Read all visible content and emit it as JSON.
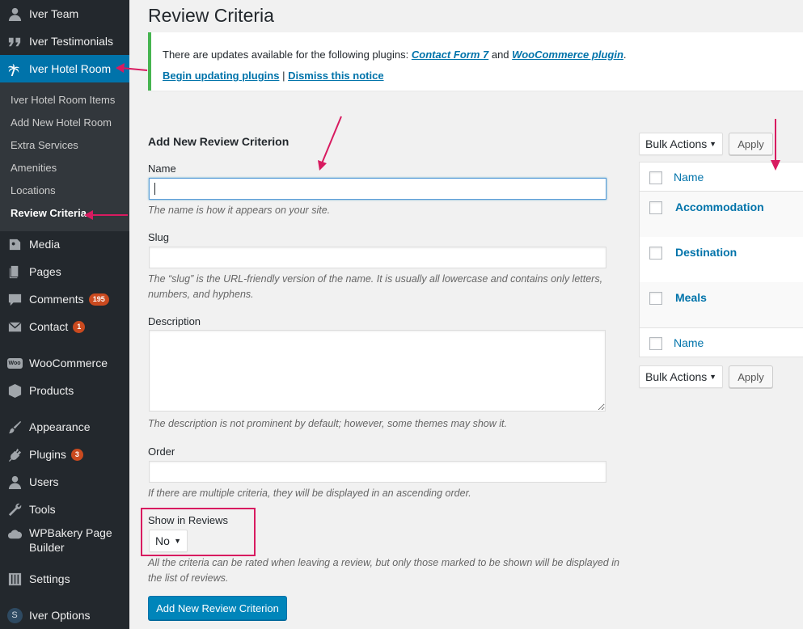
{
  "sidebar": {
    "items": [
      {
        "label": "Iver Team",
        "icon": "user-icon"
      },
      {
        "label": "Iver Testimonials",
        "icon": "quote-icon"
      },
      {
        "label": "Iver Hotel Room",
        "icon": "palm-tree-icon"
      },
      {
        "label": "Media",
        "icon": "media-icon"
      },
      {
        "label": "Pages",
        "icon": "pages-icon"
      },
      {
        "label": "Comments",
        "icon": "comment-icon",
        "badge": "195"
      },
      {
        "label": "Contact",
        "icon": "mail-icon",
        "badge": "1"
      },
      {
        "label": "WooCommerce",
        "icon": "woocommerce-icon"
      },
      {
        "label": "Products",
        "icon": "cube-icon"
      },
      {
        "label": "Appearance",
        "icon": "brush-icon"
      },
      {
        "label": "Plugins",
        "icon": "plug-icon",
        "badge": "3"
      },
      {
        "label": "Users",
        "icon": "users-icon"
      },
      {
        "label": "Tools",
        "icon": "wrench-icon"
      },
      {
        "label": "WPBakery Page Builder",
        "line1": "WPBakery Page",
        "line2": "Builder",
        "icon": "cloud-icon"
      },
      {
        "label": "Settings",
        "icon": "sliders-icon"
      },
      {
        "label": "Iver Options",
        "icon": "s-logo-icon"
      }
    ],
    "submenu": [
      "Iver Hotel Room Items",
      "Add New Hotel Room",
      "Extra Services",
      "Amenities",
      "Locations",
      "Review Criteria"
    ]
  },
  "page": {
    "title": "Review Criteria"
  },
  "notice": {
    "text_prefix": "There are updates available for the following plugins:",
    "plugin1": "Contact Form 7",
    "and": "and",
    "plugin2": "WooCommerce plugin",
    "period": ".",
    "begin_link": "Begin updating plugins",
    "separator": "|",
    "dismiss_link": "Dismiss this notice"
  },
  "form": {
    "heading": "Add New Review Criterion",
    "name_label": "Name",
    "name_value": "",
    "name_hint": "The name is how it appears on your site.",
    "slug_label": "Slug",
    "slug_value": "",
    "slug_hint_1": "The “slug” is the URL-friendly version of the name. It is usually all lowercase and contains only letters,",
    "slug_hint_2": "numbers, and hyphens.",
    "description_label": "Description",
    "description_value": "",
    "description_hint": "The description is not prominent by default; however, some themes may show it.",
    "order_label": "Order",
    "order_value": "",
    "order_hint": "If there are multiple criteria, they will be displayed in an ascending order.",
    "show_label": "Show in Reviews",
    "show_value": "No",
    "show_hint_1": "All the criteria can be rated when leaving a review, but only those marked to be shown will be displayed in",
    "show_hint_2": "the list of reviews.",
    "submit_label": "Add New Review Criterion"
  },
  "list": {
    "bulk_actions": "Bulk Actions",
    "apply": "Apply",
    "column_name": "Name",
    "rows": [
      "Accommodation",
      "Destination",
      "Meals"
    ]
  },
  "colors": {
    "sidebar_bg": "#23282d",
    "active_bg": "#0073aa",
    "link": "#0073aa",
    "notice_border": "#46b450",
    "badge": "#ca4a1f",
    "annotation": "#d81b60",
    "primary_button": "#0085ba"
  }
}
